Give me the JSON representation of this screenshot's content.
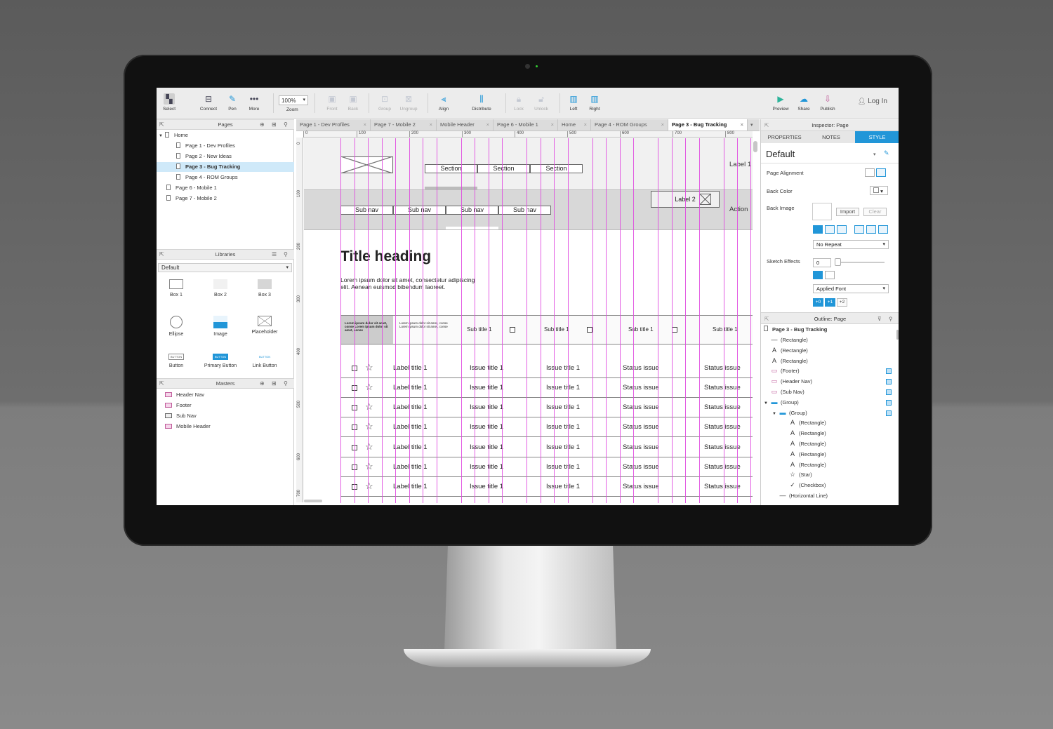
{
  "toolbar": {
    "select": "Select",
    "connect": "Connect",
    "pen": "Pen",
    "more": "More",
    "zoom_value": "100%",
    "zoom": "Zoom",
    "front": "Front",
    "back": "Back",
    "group": "Group",
    "ungroup": "Ungroup",
    "align": "Align",
    "distribute": "Distribute",
    "lock": "Lock",
    "unlock": "Unlock",
    "left": "Left",
    "right": "Right",
    "preview": "Preview",
    "share": "Share",
    "publish": "Publish",
    "login": "Log In"
  },
  "pages_panel": {
    "title": "Pages",
    "items": [
      {
        "label": "Home"
      },
      {
        "label": "Page 1 - Dev Profiles"
      },
      {
        "label": "Page 2 - New Ideas"
      },
      {
        "label": "Page 3 - Bug Tracking"
      },
      {
        "label": "Page 4 - ROM Groups"
      },
      {
        "label": "Page 6 - Mobile 1"
      },
      {
        "label": "Page 7 - Mobile 2"
      }
    ],
    "selected_index": 3
  },
  "libraries_panel": {
    "title": "Libraries",
    "selected_library": "Default",
    "widgets": [
      {
        "label": "Box 1"
      },
      {
        "label": "Box 2"
      },
      {
        "label": "Box 3"
      },
      {
        "label": "Ellipse"
      },
      {
        "label": "Image"
      },
      {
        "label": "Placeholder"
      },
      {
        "label": "Button"
      },
      {
        "label": "Primary Button"
      },
      {
        "label": "Link Button"
      }
    ],
    "button_text": "BUTTON"
  },
  "masters_panel": {
    "title": "Masters",
    "items": [
      {
        "label": "Header Nav"
      },
      {
        "label": "Footer"
      },
      {
        "label": "Sub Nav"
      },
      {
        "label": "Mobile Header"
      }
    ]
  },
  "tabs": [
    {
      "label": "Page 1 - Dev Profiles"
    },
    {
      "label": "Page 7 - Mobile 2"
    },
    {
      "label": "Mobile Header"
    },
    {
      "label": "Page 6 - Mobile 1"
    },
    {
      "label": "Home"
    },
    {
      "label": "Page 4 - ROM Groups"
    },
    {
      "label": "Page 3 - Bug Tracking"
    }
  ],
  "ruler": {
    "h": [
      "0",
      "100",
      "200",
      "300",
      "400",
      "500",
      "600",
      "700",
      "800"
    ],
    "v": [
      "0",
      "100",
      "200",
      "300",
      "400",
      "500",
      "600",
      "700"
    ]
  },
  "canvas": {
    "sections": [
      "Section",
      "Section",
      "Section"
    ],
    "label1": "Label 1",
    "label2": "Label 2",
    "action": "Action",
    "subnavs": [
      "Sub nav",
      "Sub nav",
      "Sub nav",
      "Sub nav"
    ],
    "title_heading": "Title heading",
    "lorem": "Lorem ipsum dolor sit amet, consectetur adipiscing elit. Aenean euismod bibendum laoreet.",
    "head_bold": "Lorem ipsum dolor sit amet, conse Lorem ipsum dolor sit amet, conse",
    "head_small": "Lorem ipsum dolor sit amet, conse Lorem ipsum dolor sit amet, conse",
    "subtitles": [
      "Sub title 1",
      "Sub title 1",
      "Sub title 1",
      "Sub title 1"
    ],
    "rows": [
      {
        "label": "Label title 1",
        "issue1": "Issue title 1",
        "issue2": "Issue title 1",
        "status1": "Status issue",
        "status2": "Status issue"
      },
      {
        "label": "Label title 1",
        "issue1": "Issue title 1",
        "issue2": "Issue title 1",
        "status1": "Status issue",
        "status2": "Status issue"
      },
      {
        "label": "Label title 1",
        "issue1": "Issue title 1",
        "issue2": "Issue title 1",
        "status1": "Status issue",
        "status2": "Status issue"
      },
      {
        "label": "Label title 1",
        "issue1": "Issue title 1",
        "issue2": "Issue title 1",
        "status1": "Status issue",
        "status2": "Status issue"
      },
      {
        "label": "Label title 1",
        "issue1": "Issue title 1",
        "issue2": "Issue title 1",
        "status1": "Status issue",
        "status2": "Status issue"
      },
      {
        "label": "Label title 1",
        "issue1": "Issue title 1",
        "issue2": "Issue title 1",
        "status1": "Status issue",
        "status2": "Status issue"
      },
      {
        "label": "Label title 1",
        "issue1": "Issue title 1",
        "issue2": "Issue title 1",
        "status1": "Status issue",
        "status2": "Status issue"
      }
    ]
  },
  "inspector": {
    "title": "Inspector: Page",
    "tabs": [
      "PROPERTIES",
      "NOTES",
      "STYLE"
    ],
    "active_tab": "STYLE",
    "style_name": "Default",
    "page_alignment": "Page Alignment",
    "back_color": "Back Color",
    "back_image": "Back Image",
    "import": "Import",
    "clear": "Clear",
    "repeat": "No Repeat",
    "sketch_effects": "Sketch Effects",
    "sketch_value": "0",
    "font": "Applied Font",
    "font_steps": [
      "+0",
      "+1",
      "+2"
    ]
  },
  "outline": {
    "title": "Outline: Page",
    "root": "Page 3 - Bug Tracking",
    "items": [
      {
        "label": "(Rectangle)",
        "icon": "line-icon",
        "glyph": "—",
        "indent": 0,
        "flag": false
      },
      {
        "label": "(Rectangle)",
        "icon": "text-icon",
        "glyph": "A",
        "indent": 0,
        "flag": false
      },
      {
        "label": "(Rectangle)",
        "icon": "text-icon",
        "glyph": "A",
        "indent": 0,
        "flag": false
      },
      {
        "label": "(Footer)",
        "icon": "master-icon",
        "glyph": "▭",
        "indent": 0,
        "flag": true
      },
      {
        "label": "(Header Nav)",
        "icon": "master-icon",
        "glyph": "▭",
        "indent": 0,
        "flag": true
      },
      {
        "label": "(Sub Nav)",
        "icon": "master-icon",
        "glyph": "▭",
        "indent": 0,
        "flag": true
      },
      {
        "label": "(Group)",
        "icon": "folder-icon",
        "glyph": "▬",
        "indent": 0,
        "flag": true
      },
      {
        "label": "(Group)",
        "icon": "folder-icon",
        "glyph": "▬",
        "indent": 1,
        "flag": true
      },
      {
        "label": "(Rectangle)",
        "icon": "text-icon",
        "glyph": "A",
        "indent": 2,
        "flag": false
      },
      {
        "label": "(Rectangle)",
        "icon": "text-icon",
        "glyph": "A",
        "indent": 2,
        "flag": false
      },
      {
        "label": "(Rectangle)",
        "icon": "text-icon",
        "glyph": "A",
        "indent": 2,
        "flag": false
      },
      {
        "label": "(Rectangle)",
        "icon": "text-icon",
        "glyph": "A",
        "indent": 2,
        "flag": false
      },
      {
        "label": "(Rectangle)",
        "icon": "text-icon",
        "glyph": "A",
        "indent": 2,
        "flag": false
      },
      {
        "label": "(Star)",
        "icon": "star-icon",
        "glyph": "☆",
        "indent": 2,
        "flag": false
      },
      {
        "label": "(Checkbox)",
        "icon": "check-icon",
        "glyph": "✓",
        "indent": 2,
        "flag": false
      },
      {
        "label": "(Horizontal Line)",
        "icon": "line-icon",
        "glyph": "—",
        "indent": 1,
        "flag": false
      }
    ]
  },
  "colors": {
    "accent": "#2196d8",
    "guide": "#e04be0",
    "selection": "#cfe9f9"
  }
}
